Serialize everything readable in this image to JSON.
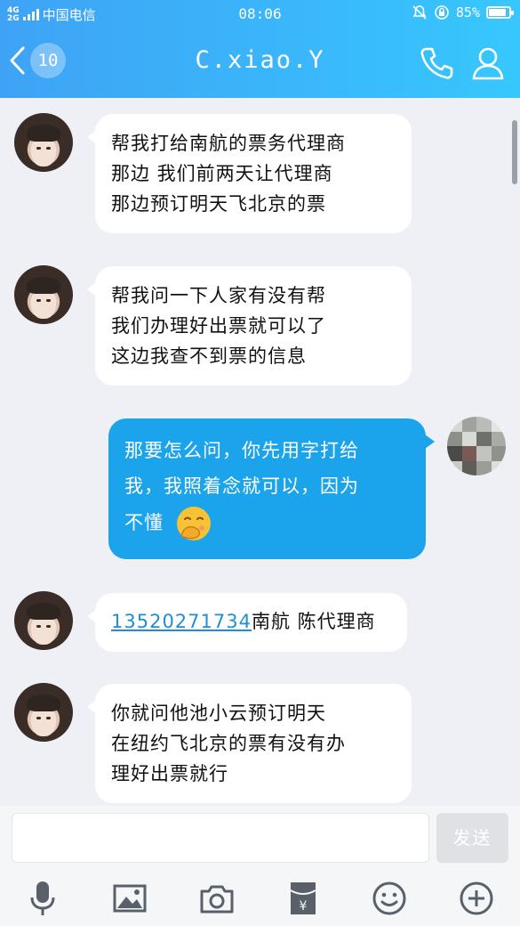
{
  "status_bar": {
    "network_top": "4G",
    "network_bottom": "2G",
    "carrier": "中国电信",
    "time": "08:06",
    "battery": "85%",
    "battery_level": 0.85
  },
  "header": {
    "unread_count": "10",
    "title": "C.xiao.Y"
  },
  "messages": [
    {
      "side": "left",
      "lines": [
        "帮我打给南航的票务代理商",
        "那边 我们前两天让代理商",
        "那边预订明天飞北京的票"
      ]
    },
    {
      "side": "left",
      "lines": [
        " 帮我问一下人家有没有帮",
        "我们办理好出票就可以了",
        "这边我查不到票的信息"
      ]
    },
    {
      "side": "right",
      "lines": [
        "那要怎么问，你先用字打给",
        "我，我照着念就可以，因为",
        "不懂"
      ]
    },
    {
      "side": "left",
      "phone": "13520271734",
      "text": "南航 陈代理商"
    },
    {
      "side": "left",
      "lines": [
        " 你就问他池小云预订明天",
        "在纽约飞北京的票有没有办",
        "理好出票就行"
      ]
    }
  ],
  "input": {
    "placeholder": "",
    "send_label": "发送"
  },
  "colors": {
    "header_start": "#3fa3f5",
    "header_end": "#37c7fd",
    "outgoing_bubble": "#1ba3ec",
    "link": "#1e8fd6"
  },
  "toolbar_icons": [
    "microphone-icon",
    "image-icon",
    "camera-icon",
    "red-packet-icon",
    "emoji-icon",
    "plus-icon"
  ]
}
